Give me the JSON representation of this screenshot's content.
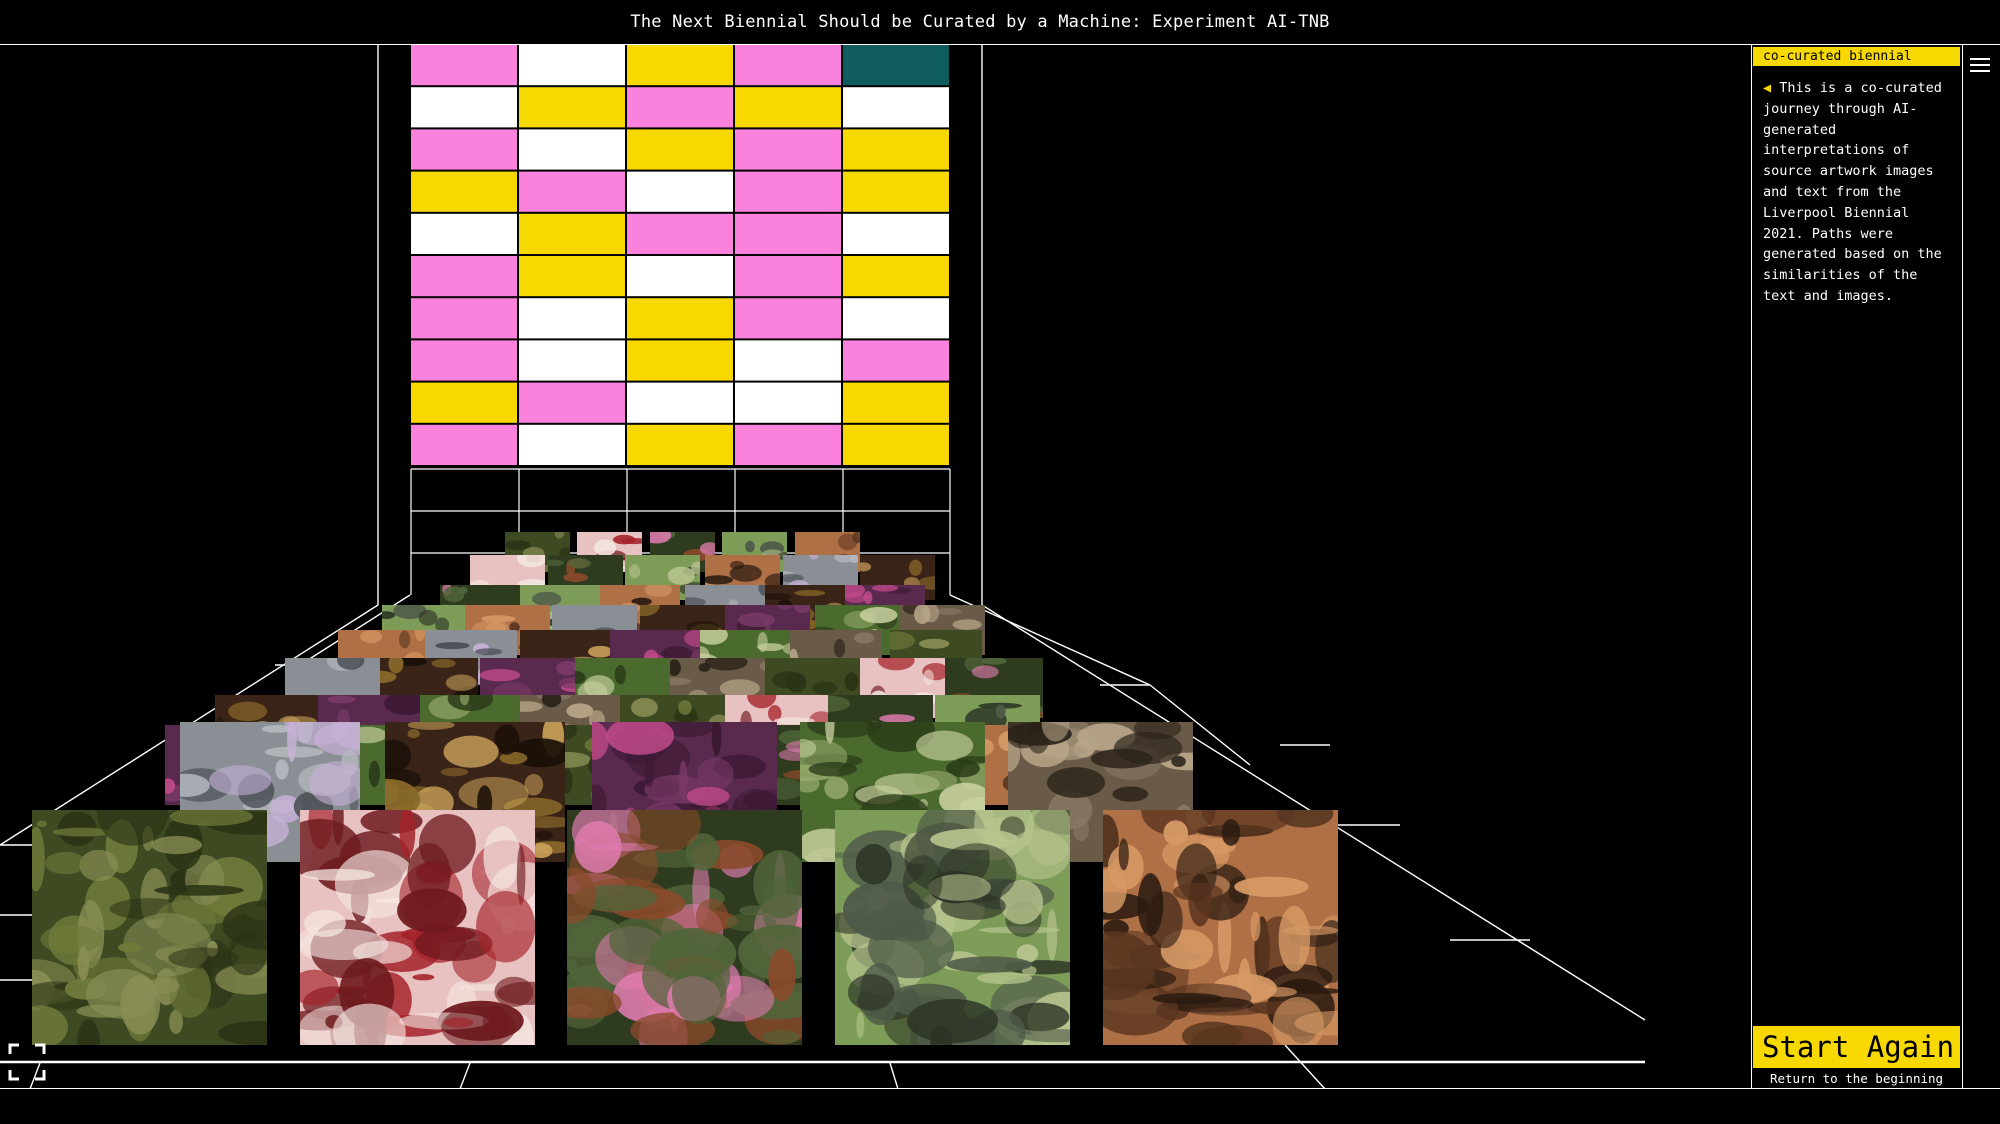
{
  "header": {
    "title": "The Next Biennial Should be Curated by a Machine: Experiment AI-TNB"
  },
  "sidebar": {
    "tab_label": "co-curated biennial",
    "description_arrow": "◀",
    "description": "This is a co-curated journey through AI-generated interpretations of source artwork images and text from the Liverpool Biennial 2021. Paths were generated based on the similarities of the text and images.",
    "menu_icon": "hamburger-icon",
    "start_again": {
      "label": "Start Again",
      "sublabel": "Return to the beginning"
    }
  },
  "controls": {
    "fullscreen_icon": "fullscreen-icon"
  },
  "colors": {
    "accent": "#f7d800",
    "pink": "#fb82dc",
    "teal": "#0e5c5e",
    "white": "#ffffff",
    "background": "#000000"
  },
  "grid_pattern": [
    [
      "pink",
      "white",
      "yellow",
      "pink",
      "teal"
    ],
    [
      "white",
      "yellow",
      "pink",
      "yellow",
      "white"
    ],
    [
      "pink",
      "white",
      "yellow",
      "pink",
      "yellow"
    ],
    [
      "yellow",
      "pink",
      "white",
      "pink",
      "yellow"
    ],
    [
      "white",
      "yellow",
      "pink",
      "pink",
      "white"
    ],
    [
      "pink",
      "yellow",
      "white",
      "pink",
      "yellow"
    ],
    [
      "pink",
      "white",
      "yellow",
      "pink",
      "white"
    ],
    [
      "pink",
      "white",
      "yellow",
      "white",
      "pink"
    ],
    [
      "yellow",
      "pink",
      "white",
      "white",
      "yellow"
    ],
    [
      "pink",
      "white",
      "yellow",
      "pink",
      "yellow"
    ]
  ],
  "artworks": [
    {
      "name": "maze-hedge-artwork",
      "palette": [
        "#3d4a22",
        "#6f7a3a",
        "#2a3315",
        "#8a8f55"
      ]
    },
    {
      "name": "pink-flesh-figures-artwork",
      "palette": [
        "#e8c2c0",
        "#a5232b",
        "#f4e4df",
        "#6e1a1e"
      ]
    },
    {
      "name": "neon-sign-map-artwork",
      "palette": [
        "#2e3b1f",
        "#8a4a2a",
        "#e07bb0",
        "#51653a"
      ]
    },
    {
      "name": "furry-creature-artwork",
      "palette": [
        "#7c9c58",
        "#4f5a48",
        "#b8c48e",
        "#2c3325"
      ]
    },
    {
      "name": "hands-marimba-artwork",
      "palette": [
        "#b07045",
        "#5a3520",
        "#d79a66",
        "#2a1a10"
      ]
    },
    {
      "name": "biennial-sign-artwork",
      "palette": [
        "#8a8f95",
        "#c8b2d8",
        "#4a4f55",
        "#b4b8bd"
      ]
    },
    {
      "name": "golden-cups-artwork",
      "palette": [
        "#3a2418",
        "#8a6a2a",
        "#1a1008",
        "#c9a05a"
      ]
    },
    {
      "name": "purple-screen-artwork",
      "palette": [
        "#5a2a4e",
        "#7a3a68",
        "#c04a8a",
        "#3a1832"
      ]
    },
    {
      "name": "green-foliage-artwork",
      "palette": [
        "#4a6a2e",
        "#95a86a",
        "#2a3a18",
        "#c8d0a0"
      ]
    },
    {
      "name": "stone-heads-artwork",
      "palette": [
        "#6a5a48",
        "#b8a68a",
        "#2a2218",
        "#8a7a68"
      ]
    }
  ]
}
